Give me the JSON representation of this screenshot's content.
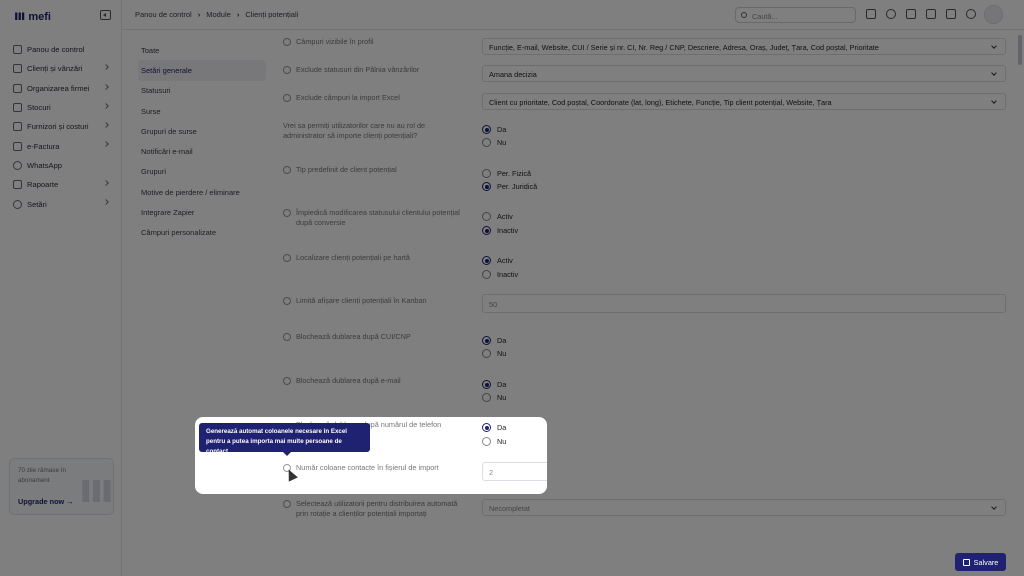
{
  "sidebar": {
    "logo": "mefi",
    "items": [
      {
        "label": "Panou de control",
        "icon": "home-icon",
        "chevron": false
      },
      {
        "label": "Clienți și vânzări",
        "icon": "users-icon",
        "chevron": true
      },
      {
        "label": "Organizarea firmei",
        "icon": "org-icon",
        "chevron": true
      },
      {
        "label": "Stocuri",
        "icon": "box-icon",
        "chevron": true
      },
      {
        "label": "Furnizori și costuri",
        "icon": "truck-icon",
        "chevron": true
      },
      {
        "label": "e-Factura",
        "icon": "invoice-icon",
        "chevron": true
      },
      {
        "label": "WhatsApp",
        "icon": "whatsapp-icon",
        "chevron": false
      },
      {
        "label": "Rapoarte",
        "icon": "report-icon",
        "chevron": true
      },
      {
        "label": "Setări",
        "icon": "gear-icon",
        "chevron": true
      }
    ],
    "upgrade": {
      "days": "70 zile rămase în abonament",
      "link": "Upgrade now →"
    }
  },
  "topbar": {
    "breadcrumb": [
      "Panou de control",
      "Module",
      "Clienți potențiali"
    ],
    "search_placeholder": "Caută..."
  },
  "tabs": [
    "Toate",
    "Setări generale",
    "Statusuri",
    "Surse",
    "Grupuri de surse",
    "Notificări e-mail",
    "Grupuri",
    "Motive de pierdere / eliminare",
    "Integrare Zapier",
    "Câmpuri personalizate"
  ],
  "active_tab": "Setări generale",
  "form": {
    "visible_fields_label": "Câmpuri vizibile în profil",
    "visible_fields_value": "Funcție, E-mail, Website, CUI / Serie și nr. CI, Nr. Reg / CNP, Descriere, Adresa, Oraș, Județ, Țara, Cod poștal, Prioritate",
    "exclude_status_label": "Exclude statusuri din Pâlnia vânzărilor",
    "exclude_status_value": "Amana decizia",
    "exclude_import_label": "Exclude câmpuri la import Excel",
    "exclude_import_value": "Client cu prioritate, Cod poștal, Coordonate (lat, long), Etichete, Funcție, Tip client potențial, Website, Țara",
    "allow_import_label": "Vrei sa permiți utilizatorilor care nu au rol de administrator să importe clienți potențiali?",
    "default_type_label": "Tip predefinit de client potențial",
    "prevent_status_label": "Împiedică modificarea statusului clientului potențial după conversie",
    "map_label": "Localizare clienți potențiali pe hartă",
    "kanban_label": "Limită afișare clienți potențiali în Kanban",
    "kanban_value": "50",
    "block_cui_label": "Blochează dublarea după CUI/CNP",
    "block_email_label": "Blochează dublarea după e-mail",
    "block_phone_label": "Blochează dublarea după numărul de telefon",
    "contact_cols_label": "Număr coloane contacte în fișierul de import",
    "contact_cols_value": "2",
    "distribution_label": "Selectează utilizatorii pentru distribuirea automată prin rotație a clienților potențiali importați",
    "distribution_value": "Necompletat",
    "yes": "Da",
    "no": "Nu",
    "fizica": "Per. Fizică",
    "juridica": "Per. Juridică",
    "activ": "Activ",
    "inactiv": "Inactiv"
  },
  "tooltip": "Generează automat coloanele necesare în Excel pentru a putea importa mai multe persoane de contact.",
  "save": "Salvare"
}
